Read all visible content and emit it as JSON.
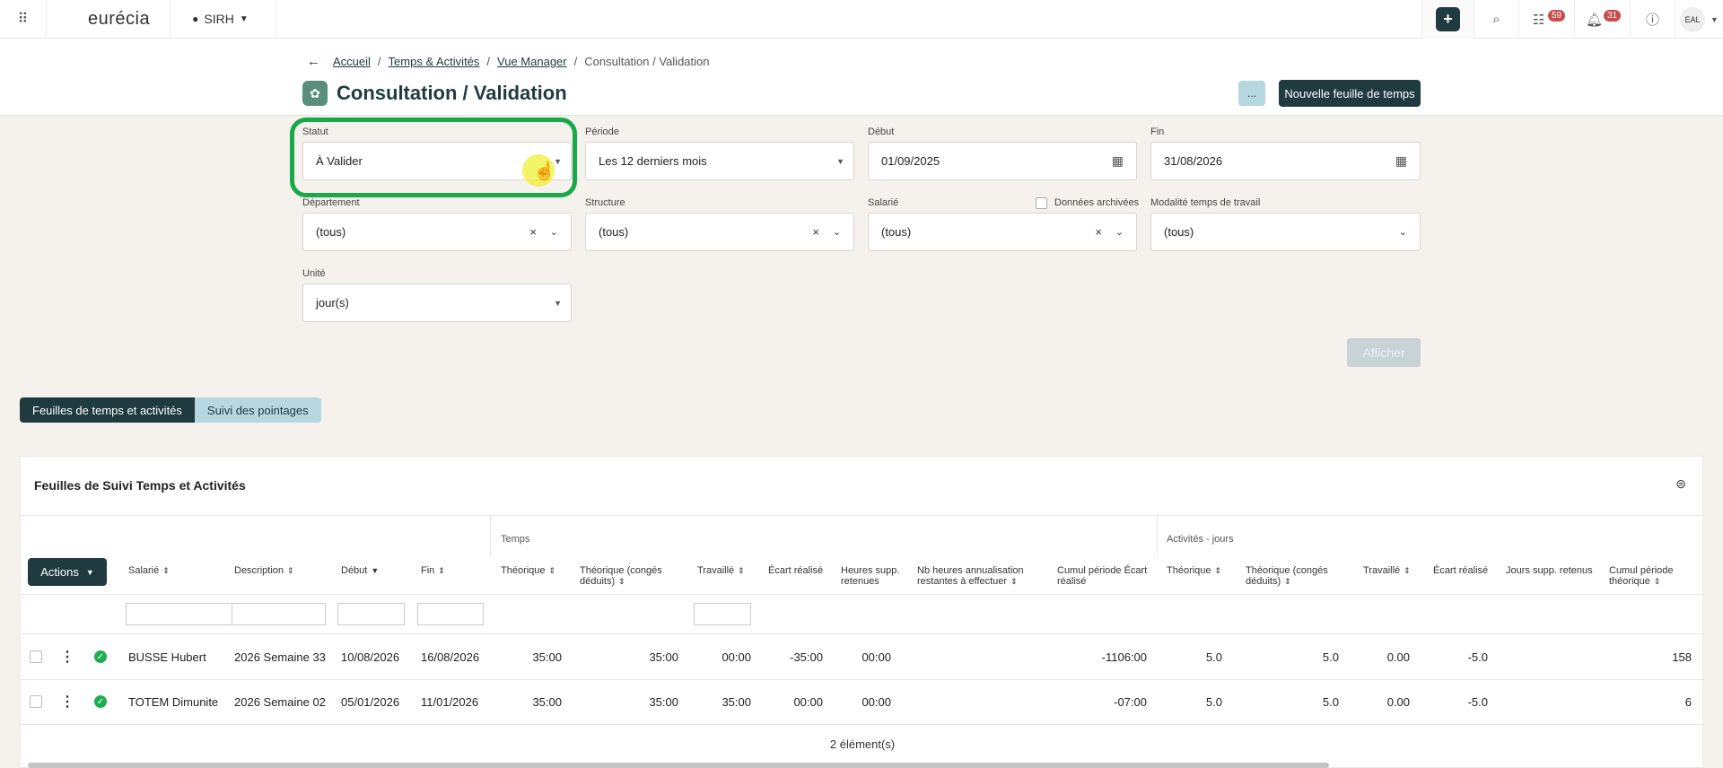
{
  "topbar": {
    "logo": "eurécia",
    "module": "SIRH",
    "badge_tasks": "59",
    "badge_notifications": "31",
    "avatar": "EAL"
  },
  "breadcrumb": {
    "items": [
      "Accueil",
      "Temps & Activités",
      "Vue Manager"
    ],
    "current": "Consultation / Validation"
  },
  "page": {
    "title": "Consultation / Validation",
    "dots_label": "...",
    "new_button": "Nouvelle feuille de temps"
  },
  "filters": {
    "statut": {
      "label": "Statut",
      "value": "À Valider"
    },
    "periode": {
      "label": "Période",
      "value": "Les 12 derniers mois"
    },
    "debut": {
      "label": "Début",
      "value": "01/09/2025"
    },
    "fin": {
      "label": "Fin",
      "value": "31/08/2026"
    },
    "departement": {
      "label": "Département",
      "value": "(tous)"
    },
    "structure": {
      "label": "Structure",
      "value": "(tous)"
    },
    "salarie": {
      "label": "Salarié",
      "value": "(tous)"
    },
    "archived": {
      "label": "Données archivées",
      "checked": false
    },
    "modalite": {
      "label": "Modalité temps de travail",
      "value": "(tous)"
    },
    "unite": {
      "label": "Unité",
      "value": "jour(s)"
    },
    "show_button": "Afficher"
  },
  "tabs": [
    "Feuilles de temps et activités",
    "Suivi des pointages"
  ],
  "table": {
    "title": "Feuilles de Suivi Temps et Activités",
    "group_temps": "Temps",
    "group_activites": "Activités - jours",
    "actions_label": "Actions",
    "columns": {
      "salarie": "Salarié",
      "description": "Description",
      "debut": "Début",
      "fin": "Fin",
      "theorique": "Théorique",
      "theorique_conges": "Théorique (congés déduits)",
      "travaille": "Travaillé",
      "ecart": "Écart réalisé",
      "heures_supp": "Heures supp. retenues",
      "nb_heures": "Nb heures annualisation restantes à effectuer",
      "cumul_ecart": "Cumul période Écart réalisé",
      "a_theorique": "Théorique",
      "a_theorique_conges": "Théorique (congés déduits)",
      "a_travaille": "Travaillé",
      "a_ecart": "Écart réalisé",
      "a_jours_supp": "Jours supp. retenus",
      "a_cumul": "Cumul période théorique"
    },
    "rows": [
      {
        "salarie": "BUSSE Hubert",
        "description": "2026 Semaine 33",
        "debut": "10/08/2026",
        "fin": "16/08/2026",
        "theorique": "35:00",
        "theorique_conges": "35:00",
        "travaille": "00:00",
        "ecart": "-35:00",
        "heures_supp": "00:00",
        "cumul_ecart": "-1106:00",
        "a_theorique": "5.0",
        "a_theorique_conges": "5.0",
        "a_travaille": "0.00",
        "a_ecart": "-5.0",
        "a_cumul": "158"
      },
      {
        "salarie": "TOTEM Dimunite",
        "description": "2026 Semaine 02",
        "debut": "05/01/2026",
        "fin": "11/01/2026",
        "theorique": "35:00",
        "theorique_conges": "35:00",
        "travaille": "35:00",
        "ecart": "00:00",
        "heures_supp": "00:00",
        "cumul_ecart": "-07:00",
        "a_theorique": "5.0",
        "a_theorique_conges": "5.0",
        "a_travaille": "0.00",
        "a_ecart": "-5.0",
        "a_cumul": "6"
      }
    ],
    "count": "2 élément(s)"
  }
}
